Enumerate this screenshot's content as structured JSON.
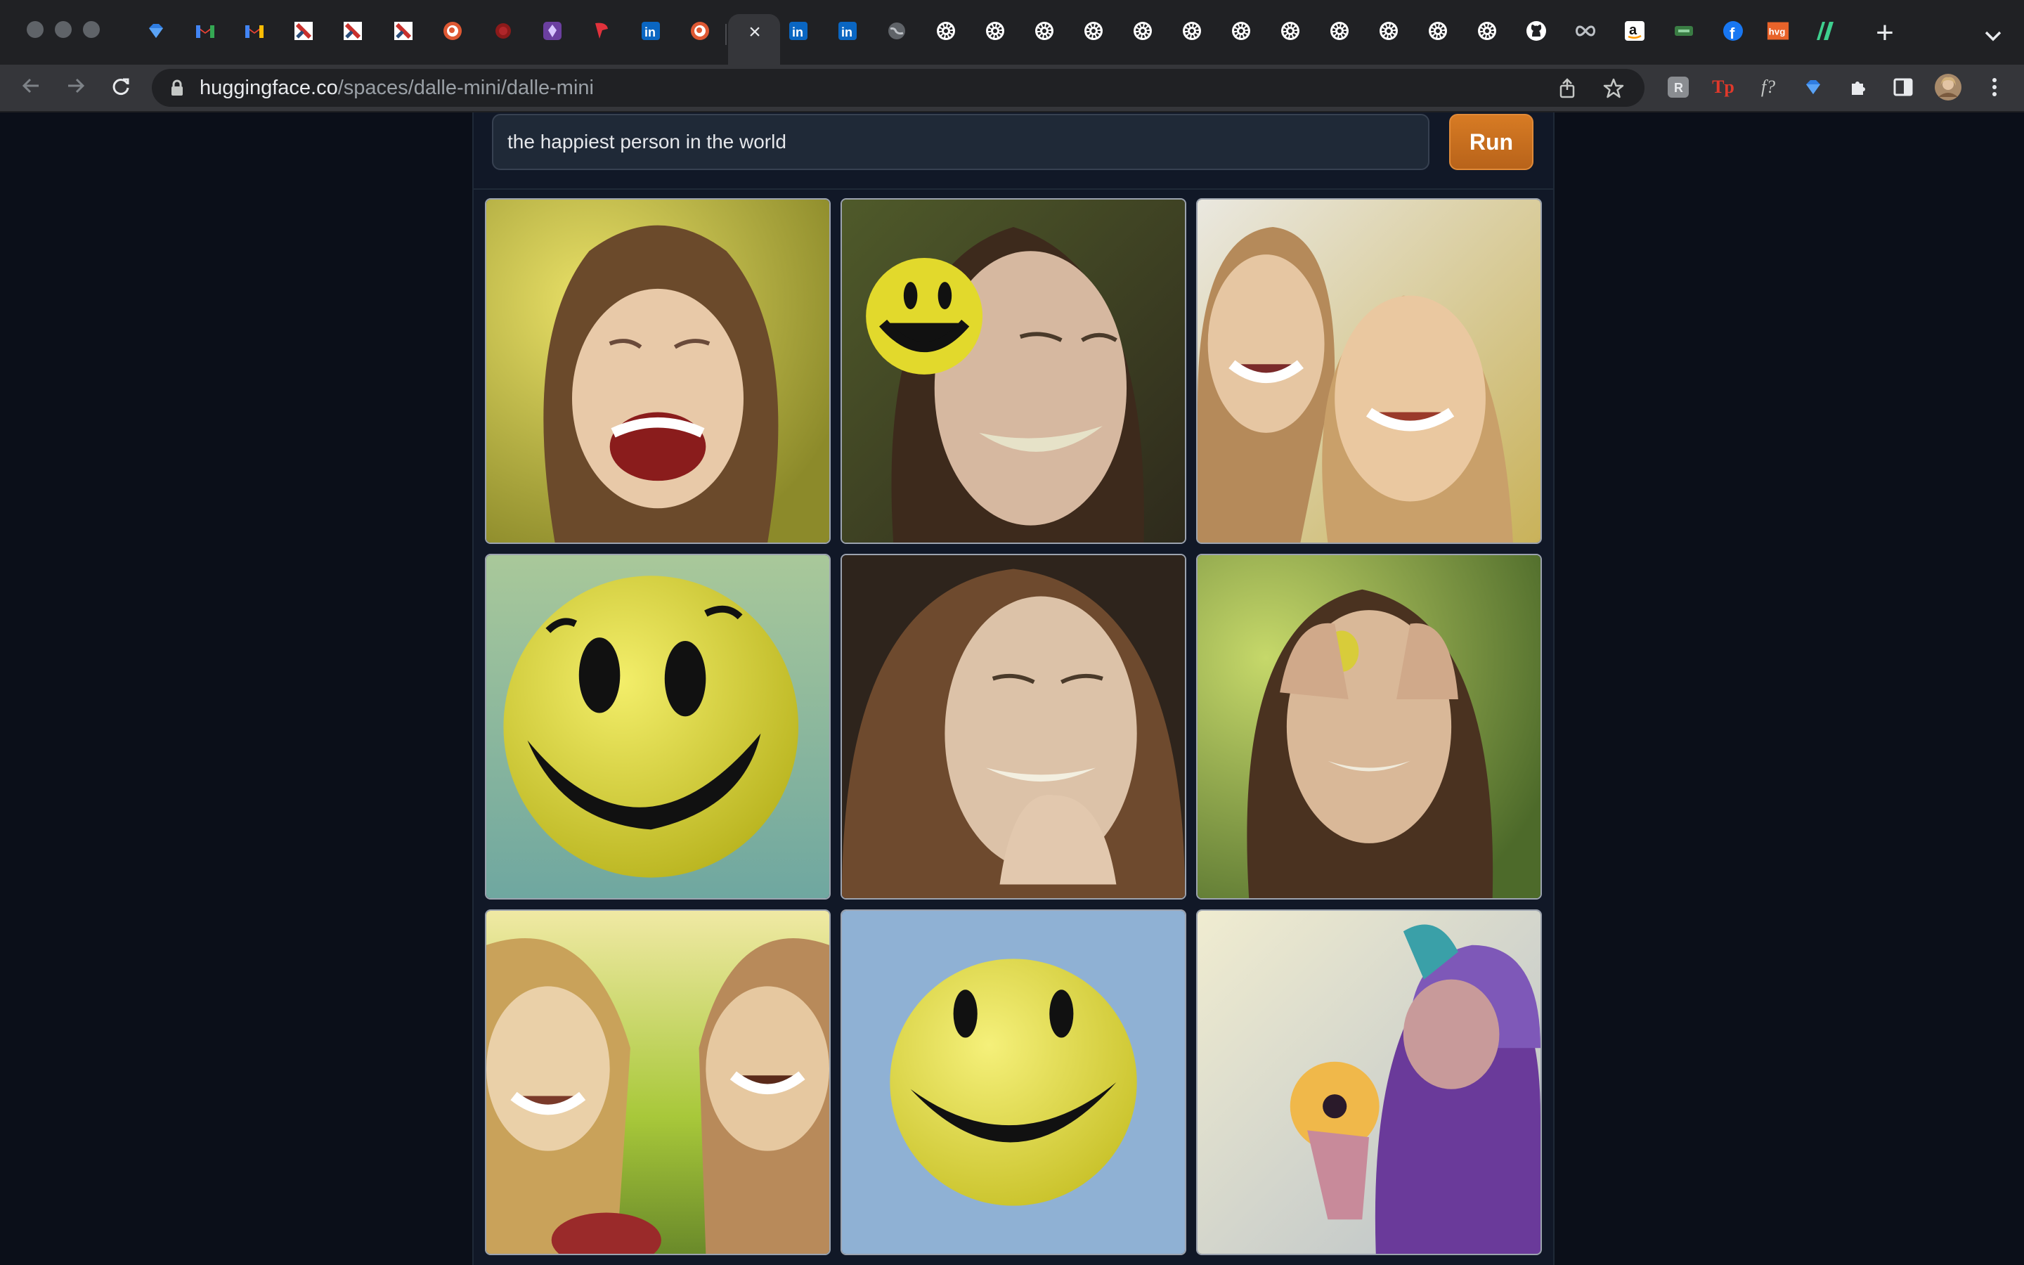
{
  "browser": {
    "tabs_favicons": [
      "gem-icon",
      "gmail-icon",
      "gmail-icon",
      "notion-icon",
      "notion-icon",
      "notion-icon",
      "duckduckgo-icon",
      "cocktail-icon",
      "obsidian-icon",
      "raindrop-icon",
      "linkedin-icon",
      "duckduckgo-icon",
      "close-icon",
      "linkedin-icon",
      "linkedin-icon",
      "globe-icon",
      "huggingface-icon",
      "huggingface-icon",
      "huggingface-icon",
      "huggingface-icon",
      "huggingface-icon",
      "huggingface-icon",
      "huggingface-icon",
      "huggingface-icon",
      "huggingface-icon",
      "huggingface-icon",
      "huggingface-icon",
      "github-icon",
      "infinity-icon",
      "amazon-icon",
      "ticket-icon",
      "facebook-icon",
      "hvg-icon",
      "stripe-icon"
    ],
    "url_host": "huggingface.co",
    "url_path": "/spaces/dalle-mini/dalle-mini"
  },
  "app": {
    "prompt_value": "the happiest person in the world",
    "run_label": "Run",
    "accent_color": "#c8701f",
    "images": [
      {
        "name": "gallery-image-1",
        "subject": "girl laughing with long brown hair"
      },
      {
        "name": "gallery-image-2",
        "subject": "smiling woman with yellow smiley ball"
      },
      {
        "name": "gallery-image-3",
        "subject": "two women laughing"
      },
      {
        "name": "gallery-image-4",
        "subject": "yellow smiley ball"
      },
      {
        "name": "gallery-image-5",
        "subject": "laughing woman covering mouth"
      },
      {
        "name": "gallery-image-6",
        "subject": "woman covering eyes laughing"
      },
      {
        "name": "gallery-image-7",
        "subject": "two girls laughing outdoors"
      },
      {
        "name": "gallery-image-8",
        "subject": "yellow smiley face on blue"
      },
      {
        "name": "gallery-image-9",
        "subject": "purple-toned woman holding donut"
      }
    ]
  }
}
